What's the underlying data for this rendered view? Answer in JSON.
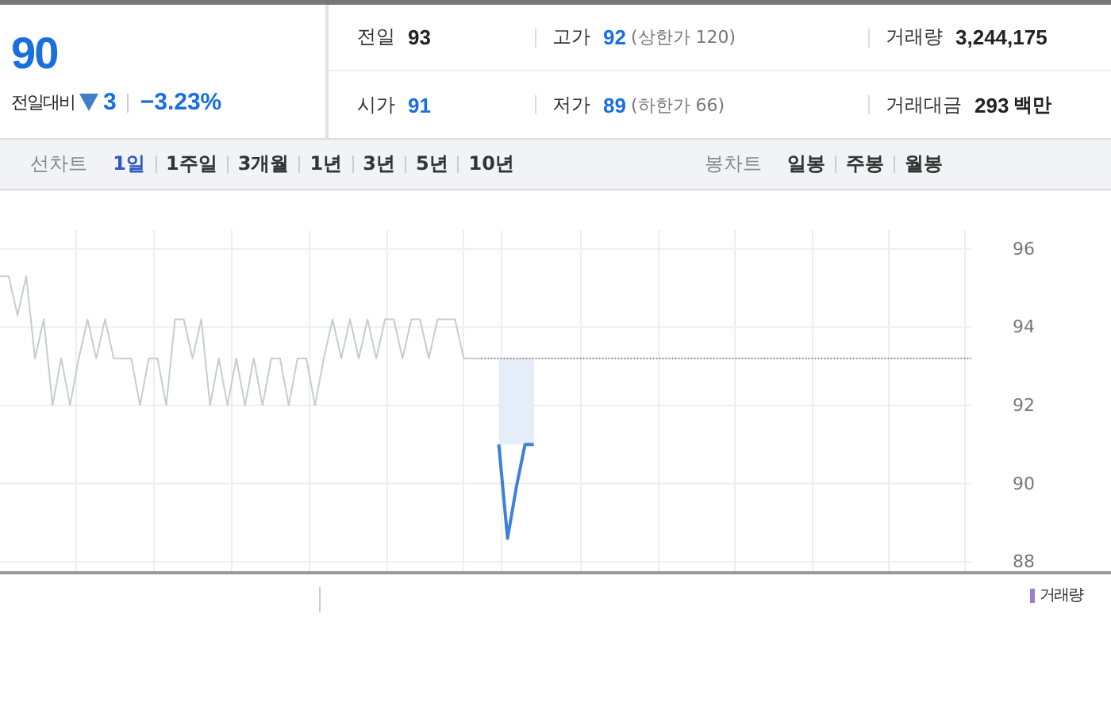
{
  "price": {
    "current": "90",
    "change_label": "전일대비",
    "down": true,
    "change": "3",
    "change_rate": "−3.23%"
  },
  "stats": [
    {
      "label": "전일",
      "value": "93",
      "color": "#222222"
    },
    {
      "label": "고가",
      "value": "92",
      "color": "#1a6fe0",
      "note": "(상한가 120)"
    },
    {
      "label": "거래량",
      "value": "3,244,175",
      "color": "#222222"
    },
    {
      "label": "시가",
      "value": "91",
      "color": "#1a6fe0"
    },
    {
      "label": "저가",
      "value": "89",
      "color": "#1a6fe0",
      "note": "(하한가 66)"
    },
    {
      "label": "거래대금",
      "value": "293",
      "color": "#222222",
      "unit": "백만"
    }
  ],
  "line_chart_tabs": {
    "label": "선차트",
    "items": [
      {
        "label": "1일",
        "selected": true
      },
      {
        "label": "1주일",
        "selected": false
      },
      {
        "label": "3개월",
        "selected": false
      },
      {
        "label": "1년",
        "selected": false
      },
      {
        "label": "3년",
        "selected": false
      },
      {
        "label": "5년",
        "selected": false
      },
      {
        "label": "10년",
        "selected": false
      }
    ]
  },
  "candle_chart_tabs": {
    "label": "봉차트",
    "items": [
      {
        "label": "일봉",
        "selected": false
      },
      {
        "label": "주봉",
        "selected": false
      },
      {
        "label": "월봉",
        "selected": false
      }
    ]
  },
  "chart": {
    "chart_data": {
      "type": "line",
      "categories": [
        null,
        null,
        null,
        null,
        null,
        null,
        null,
        null,
        null,
        null,
        null,
        null,
        null,
        null,
        null,
        null,
        null,
        null,
        null,
        null,
        null,
        null,
        null,
        null,
        null,
        null,
        null,
        null,
        null,
        null,
        null,
        null,
        null,
        null,
        null,
        null,
        null,
        null,
        null,
        null,
        null,
        null,
        null,
        null,
        null,
        null,
        null,
        null,
        null,
        null,
        null,
        null,
        null,
        null,
        null,
        null,
        null,
        null,
        null,
        null,
        null,
        null,
        null,
        null,
        null,
        null,
        null,
        null,
        null,
        null,
        null,
        null,
        null,
        null,
        null,
        null,
        null,
        null,
        null,
        null,
        null,
        null,
        null,
        null,
        null,
        null,
        null,
        null,
        null,
        null,
        null,
        null,
        null,
        null,
        null,
        null,
        null,
        null,
        null,
        null,
        null,
        null,
        null,
        null,
        null,
        null,
        null,
        null,
        null,
        null,
        null,
        null
      ],
      "ylim": [
        87.8,
        96.4
      ],
      "yticks": [
        88,
        90,
        92,
        94,
        96
      ],
      "series": [
        {
          "color": "#c8cbd0",
          "values": [
            95.3,
            95.3,
            94.3,
            95.3,
            93.2,
            94.2,
            92,
            93.2,
            92,
            93.2,
            94.2,
            93.2,
            94.2,
            93.2,
            93.2,
            93.2,
            92,
            93.2,
            93.2,
            92,
            94.2,
            94.2,
            93.2,
            94.2,
            92,
            93.2,
            92,
            93.2,
            92,
            93.2,
            92,
            93.2,
            93.2,
            92,
            93.2,
            93.2,
            92,
            93.2,
            94.2,
            93.2,
            94.2,
            93.2,
            94.2,
            93.2,
            94.2,
            94.2,
            93.2,
            94.2,
            94.2,
            93.2,
            94.2,
            94.2,
            94.2,
            93.2,
            93.2,
            93.2,
            null,
            null,
            null,
            null,
            null,
            null,
            null,
            null,
            null,
            null,
            null,
            null,
            null,
            null,
            null,
            null,
            null,
            null,
            null,
            null,
            null,
            null,
            null,
            null,
            null,
            null,
            null,
            null,
            null,
            null,
            null,
            null,
            null,
            null,
            null,
            null,
            null,
            null,
            null,
            null,
            null,
            null,
            null,
            null,
            null,
            null,
            null,
            null,
            null,
            null,
            null,
            null,
            null,
            null,
            null,
            null
          ]
        },
        {
          "color": "#3f7fe0",
          "values": [
            null,
            null,
            null,
            null,
            null,
            null,
            null,
            null,
            null,
            null,
            null,
            null,
            null,
            null,
            null,
            null,
            null,
            null,
            null,
            null,
            null,
            null,
            null,
            null,
            null,
            null,
            null,
            null,
            null,
            null,
            null,
            null,
            null,
            null,
            null,
            null,
            null,
            null,
            null,
            null,
            null,
            null,
            null,
            null,
            null,
            null,
            null,
            null,
            null,
            null,
            null,
            null,
            null,
            null,
            null,
            null,
            null,
            91,
            88.6,
            89.9,
            91,
            91,
            null,
            null,
            null,
            null,
            null,
            null,
            null,
            null,
            null,
            null,
            null,
            null,
            null,
            null,
            null,
            null,
            null,
            null,
            null,
            null,
            null,
            null,
            null,
            null,
            null,
            null,
            null,
            null,
            null,
            null,
            null,
            null,
            null,
            null,
            null,
            null,
            null,
            null,
            null,
            null,
            null,
            null,
            null,
            null,
            null,
            null,
            null,
            null,
            null,
            null
          ]
        },
        {
          "color": "#888888",
          "line_style": "dotted",
          "values": [
            null,
            null,
            null,
            null,
            null,
            null,
            null,
            null,
            null,
            null,
            null,
            null,
            null,
            null,
            null,
            null,
            null,
            null,
            null,
            null,
            null,
            null,
            null,
            null,
            null,
            null,
            null,
            null,
            null,
            null,
            null,
            null,
            null,
            null,
            null,
            null,
            null,
            null,
            null,
            null,
            null,
            null,
            null,
            null,
            null,
            null,
            null,
            null,
            null,
            null,
            null,
            null,
            null,
            null,
            null,
            93.2,
            93.2,
            93.2,
            93.2,
            93.2,
            93.2,
            93.2,
            93.2,
            93.2,
            93.2,
            93.2,
            93.2,
            93.2,
            93.2,
            93.2,
            93.2,
            93.2,
            93.2,
            93.2,
            93.2,
            93.2,
            93.2,
            93.2,
            93.2,
            93.2,
            93.2,
            93.2,
            93.2,
            93.2,
            93.2,
            93.2,
            93.2,
            93.2,
            93.2,
            93.2,
            93.2,
            93.2,
            93.2,
            93.2,
            93.2,
            93.2,
            93.2,
            93.2,
            93.2,
            93.2,
            93.2,
            93.2,
            93.2,
            93.2,
            93.2,
            93.2,
            93.2,
            93.2,
            93.2,
            93.2,
            93.2,
            93.2
          ]
        }
      ],
      "grid": true
    },
    "legend": "거래량"
  }
}
